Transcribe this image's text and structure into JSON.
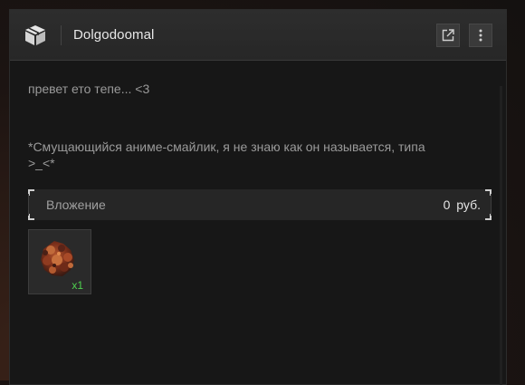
{
  "window": {
    "title": "Dolgodoomal",
    "logo_icon": "box-icon",
    "open_external_icon": "open-external-icon",
    "more_icon": "more-vertical-icon"
  },
  "message": {
    "line1": "превет ето тепе... <3",
    "line2": "*Смущающийся аниме-смайлик, я не знаю как он называется, типа",
    "line3": ">_<*"
  },
  "attachment": {
    "label": "Вложение",
    "amount": "0 руб."
  },
  "item": {
    "icon": "ore-chunk-icon",
    "quantity": "x1",
    "quantity_color": "#4fd14f"
  },
  "colors": {
    "accent_text": "#e8e8e8",
    "body_text": "#9a9a9a",
    "panel_bg": "#171717",
    "header_bg": "#2a2a2a"
  }
}
